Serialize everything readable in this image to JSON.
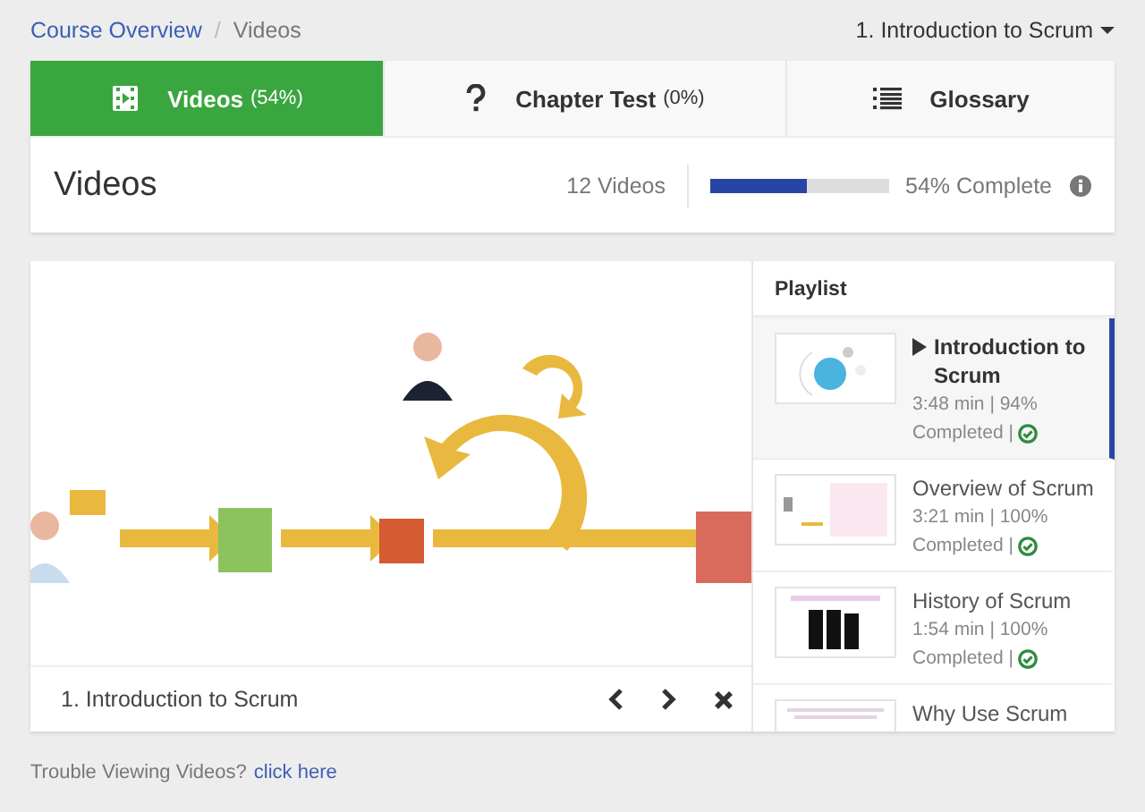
{
  "breadcrumb_separator": "/",
  "breadcrumb": [
    {
      "label": "Course Overview",
      "kind": "link"
    },
    {
      "label": "Videos",
      "kind": "current"
    }
  ],
  "chapter_select": "1. Introduction to Scrum",
  "tabs": [
    {
      "label": "Videos",
      "count": "(54%)",
      "kind": "film",
      "selected": true
    },
    {
      "label": "Chapter Test",
      "count": "(0%)",
      "kind": "question",
      "selected": false
    },
    {
      "label": "Glossary",
      "kind": "list",
      "selected": false
    }
  ],
  "summary": {
    "title": "Videos",
    "video_count": "12 Videos",
    "progress": {
      "level": 0.54,
      "reading": "54% Complete"
    }
  },
  "player": {
    "caption": "1. Introduction to Scrum"
  },
  "playlist": {
    "title": "Playlist",
    "items": [
      {
        "title": "Introduction to Scrum",
        "meta": "3:48 min | 94%",
        "status": "Completed |",
        "completed": true,
        "selected": true
      },
      {
        "title": "Overview of Scrum",
        "meta": "3:21 min | 100%",
        "status": "Completed |",
        "completed": true,
        "selected": false
      },
      {
        "title": "History of Scrum",
        "meta": "1:54 min | 100%",
        "status": "Completed |",
        "completed": true,
        "selected": false
      },
      {
        "title": "Why Use Scrum",
        "selected": false
      }
    ]
  },
  "footer": {
    "text": "Trouble Viewing Videos?",
    "link": "click here"
  }
}
